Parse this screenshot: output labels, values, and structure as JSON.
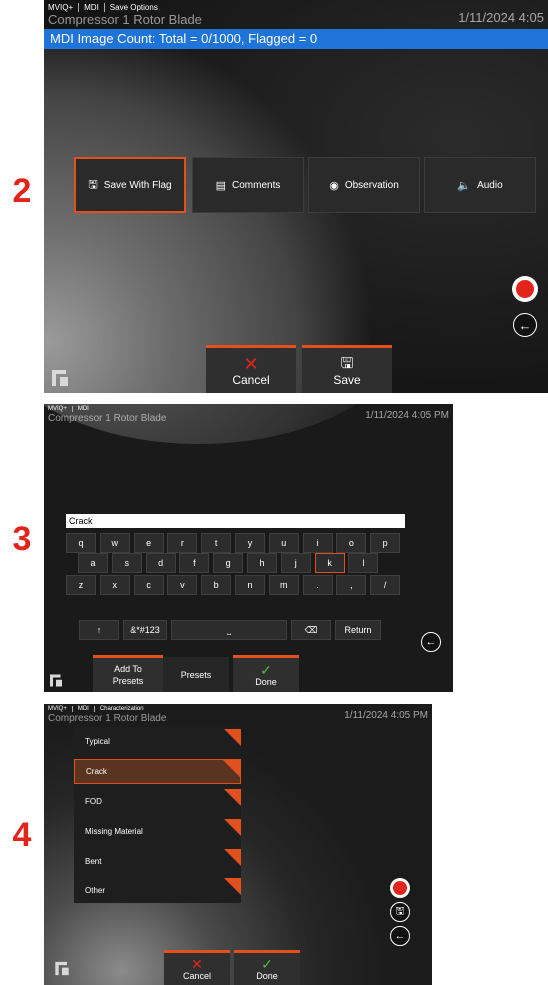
{
  "steps": {
    "s2": "2",
    "s3": "3",
    "s4": "4"
  },
  "screen2": {
    "status": {
      "app": "MVIQ+",
      "mode": "MDI",
      "tab": "Save Options"
    },
    "overlay_title": "Compressor 1 Rotor Blade",
    "datetime": "1/11/2024 4:05",
    "info_bar": "MDI Image Count: Total = 0/1000, Flagged = 0",
    "options": [
      {
        "label": "Save With Flag",
        "icon": "flag-save-icon"
      },
      {
        "label": "Comments",
        "icon": "document-icon"
      },
      {
        "label": "Observation",
        "icon": "eye-icon"
      },
      {
        "label": "Audio",
        "icon": "speaker-icon"
      }
    ],
    "softkeys": {
      "cancel": "Cancel",
      "save": "Save"
    }
  },
  "screen3": {
    "status": {
      "app": "MVIQ+",
      "mode": "MDI"
    },
    "overlay_title": "Compressor 1 Rotor Blade",
    "datetime": "1/11/2024 4:05 PM",
    "input_value": "Crack",
    "rows": [
      [
        "q",
        "w",
        "e",
        "r",
        "t",
        "y",
        "u",
        "i",
        "o",
        "p"
      ],
      [
        "a",
        "s",
        "d",
        "f",
        "g",
        "h",
        "j",
        "k",
        "l"
      ],
      [
        "z",
        "x",
        "c",
        "v",
        "b",
        "n",
        "m",
        ".",
        ",",
        "/"
      ]
    ],
    "special": {
      "shift": "↑",
      "symbols": "&*#123",
      "space": "⎵",
      "backspace": "⌫",
      "return": "Return"
    },
    "softkeys": {
      "add": "Add To Presets",
      "presets": "Presets",
      "done": "Done"
    }
  },
  "screen4": {
    "status": {
      "app": "MVIQ+",
      "mode": "MDI",
      "tab": "Characterization"
    },
    "overlay_title": "Compressor 1 Rotor Blade",
    "datetime": "1/11/2024 4:05 PM",
    "items": [
      "Typical",
      "Crack",
      "FOD",
      "Missing Material",
      "Bent",
      "Other"
    ],
    "softkeys": {
      "cancel": "Cancel",
      "done": "Done"
    }
  },
  "colors": {
    "accent": "#e2501e",
    "info_bar": "#1f74d9",
    "record": "#e3241b",
    "step_number": "#e3241b"
  }
}
